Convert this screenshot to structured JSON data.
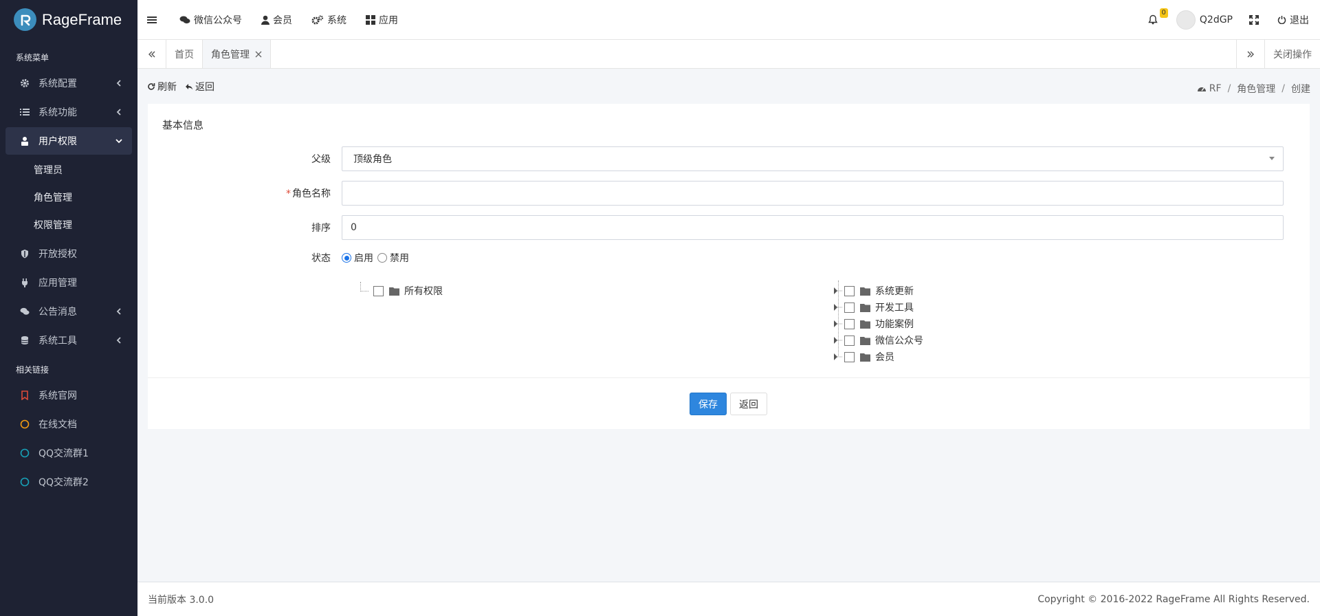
{
  "brand": {
    "name": "RageFrame"
  },
  "sidebar": {
    "header_system": "系统菜单",
    "items": [
      {
        "label": "系统配置",
        "icon": "gear-icon"
      },
      {
        "label": "系统功能",
        "icon": "list-icon"
      },
      {
        "label": "用户权限",
        "icon": "user-lock-icon"
      }
    ],
    "sub_items": [
      {
        "label": "管理员"
      },
      {
        "label": "角色管理"
      },
      {
        "label": "权限管理"
      }
    ],
    "items2": [
      {
        "label": "开放授权",
        "icon": "shield-icon"
      },
      {
        "label": "应用管理",
        "icon": "plug-icon"
      },
      {
        "label": "公告消息",
        "icon": "comments-icon"
      },
      {
        "label": "系统工具",
        "icon": "database-icon"
      }
    ],
    "header_links": "相关链接",
    "links": [
      {
        "label": "系统官网",
        "color": "#dd4b39"
      },
      {
        "label": "在线文档",
        "color": "#f39c12"
      },
      {
        "label": "QQ交流群1",
        "color": "#17a2b8"
      },
      {
        "label": "QQ交流群2",
        "color": "#17a2b8"
      }
    ]
  },
  "navbar": {
    "links": [
      {
        "label": "微信公众号"
      },
      {
        "label": "会员"
      },
      {
        "label": "系统"
      },
      {
        "label": "应用"
      }
    ],
    "notification_count": "0",
    "username": "Q2dGP",
    "logout": "退出"
  },
  "tabs": {
    "items": [
      {
        "label": "首页"
      },
      {
        "label": "角色管理"
      }
    ],
    "close_ops": "关闭操作"
  },
  "toolbar": {
    "refresh": "刷新",
    "back": "返回"
  },
  "breadcrumb": {
    "items": [
      "RF",
      "角色管理",
      "创建"
    ]
  },
  "form": {
    "title": "基本信息",
    "parent_label": "父级",
    "parent_value": "顶级角色",
    "name_label": "角色名称",
    "name_value": "",
    "sort_label": "排序",
    "sort_value": "0",
    "status_label": "状态",
    "status_options": [
      "启用",
      "禁用"
    ],
    "status_selected": "启用"
  },
  "tree_left": {
    "label": "所有权限"
  },
  "tree_right": [
    "系统更新",
    "开发工具",
    "功能案例",
    "微信公众号",
    "会员"
  ],
  "buttons": {
    "save": "保存",
    "back": "返回"
  },
  "footer": {
    "version": "当前版本 3.0.0",
    "copyright": "Copyright © 2016-2022 RageFrame All Rights Reserved."
  },
  "colors": {
    "sidebar_bg": "#1e2233",
    "primary": "#2e86de"
  }
}
